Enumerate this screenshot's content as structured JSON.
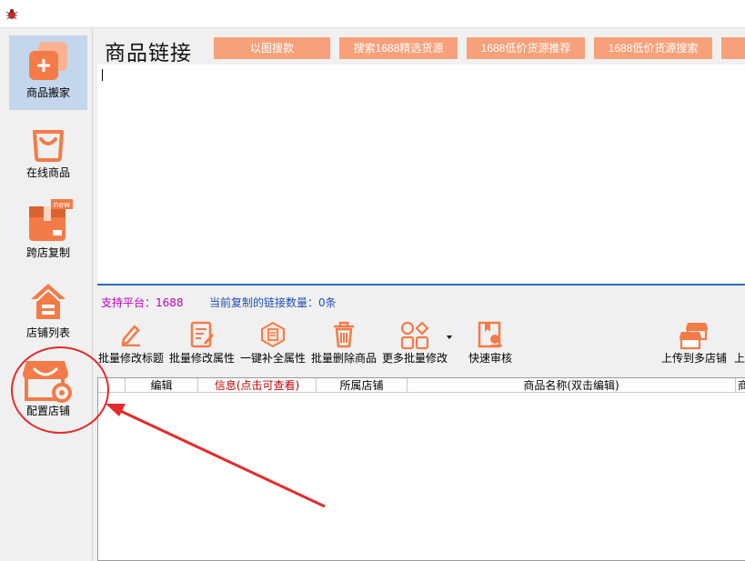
{
  "colors": {
    "accent": "#f7a17a",
    "icon_orange": "#f37b48",
    "sidebar_active": "#c3d6ec",
    "link_purple": "#c000c0",
    "link_blue": "#1f4fb4",
    "annotation_red": "#e32b2b",
    "info_red": "#c00000"
  },
  "sidebar": {
    "items": [
      {
        "label": "商品搬家",
        "icon": "plus-square-icon",
        "active": true
      },
      {
        "label": "在线商品",
        "icon": "shopping-bag-icon",
        "active": false
      },
      {
        "label": "跨店复制",
        "icon": "box-new-icon",
        "active": false
      },
      {
        "label": "店铺列表",
        "icon": "house-icon",
        "active": false
      },
      {
        "label": "配置店铺",
        "icon": "shop-gear-icon",
        "active": false
      }
    ]
  },
  "main": {
    "title": "商品链接",
    "top_buttons": [
      "以图搜款",
      "搜索1688精选货源",
      "1688低价货源推荐",
      "1688低价货源搜索"
    ],
    "supported_platform": "支持平台：1688",
    "link_count": "当前复制的链接数量：0条",
    "toolbar": [
      {
        "label": "批量修改标题",
        "icon": "pencil-icon"
      },
      {
        "label": "批量修改属性",
        "icon": "document-edit-icon"
      },
      {
        "label": "一键补全属性",
        "icon": "hexagon-doc-icon"
      },
      {
        "label": "批量删除商品",
        "icon": "trash-icon"
      },
      {
        "label": "更多批量修改",
        "icon": "grid-shapes-icon"
      },
      {
        "label": "快速审核",
        "icon": "audit-icon"
      },
      {
        "label": "上传到多店铺",
        "icon": "multi-shop-upload-icon"
      },
      {
        "label": "上",
        "icon": ""
      }
    ],
    "grid_columns": [
      "编辑",
      "信息(点击可查看)",
      "所属店铺",
      "商品名称(双击编辑)",
      "商"
    ]
  }
}
